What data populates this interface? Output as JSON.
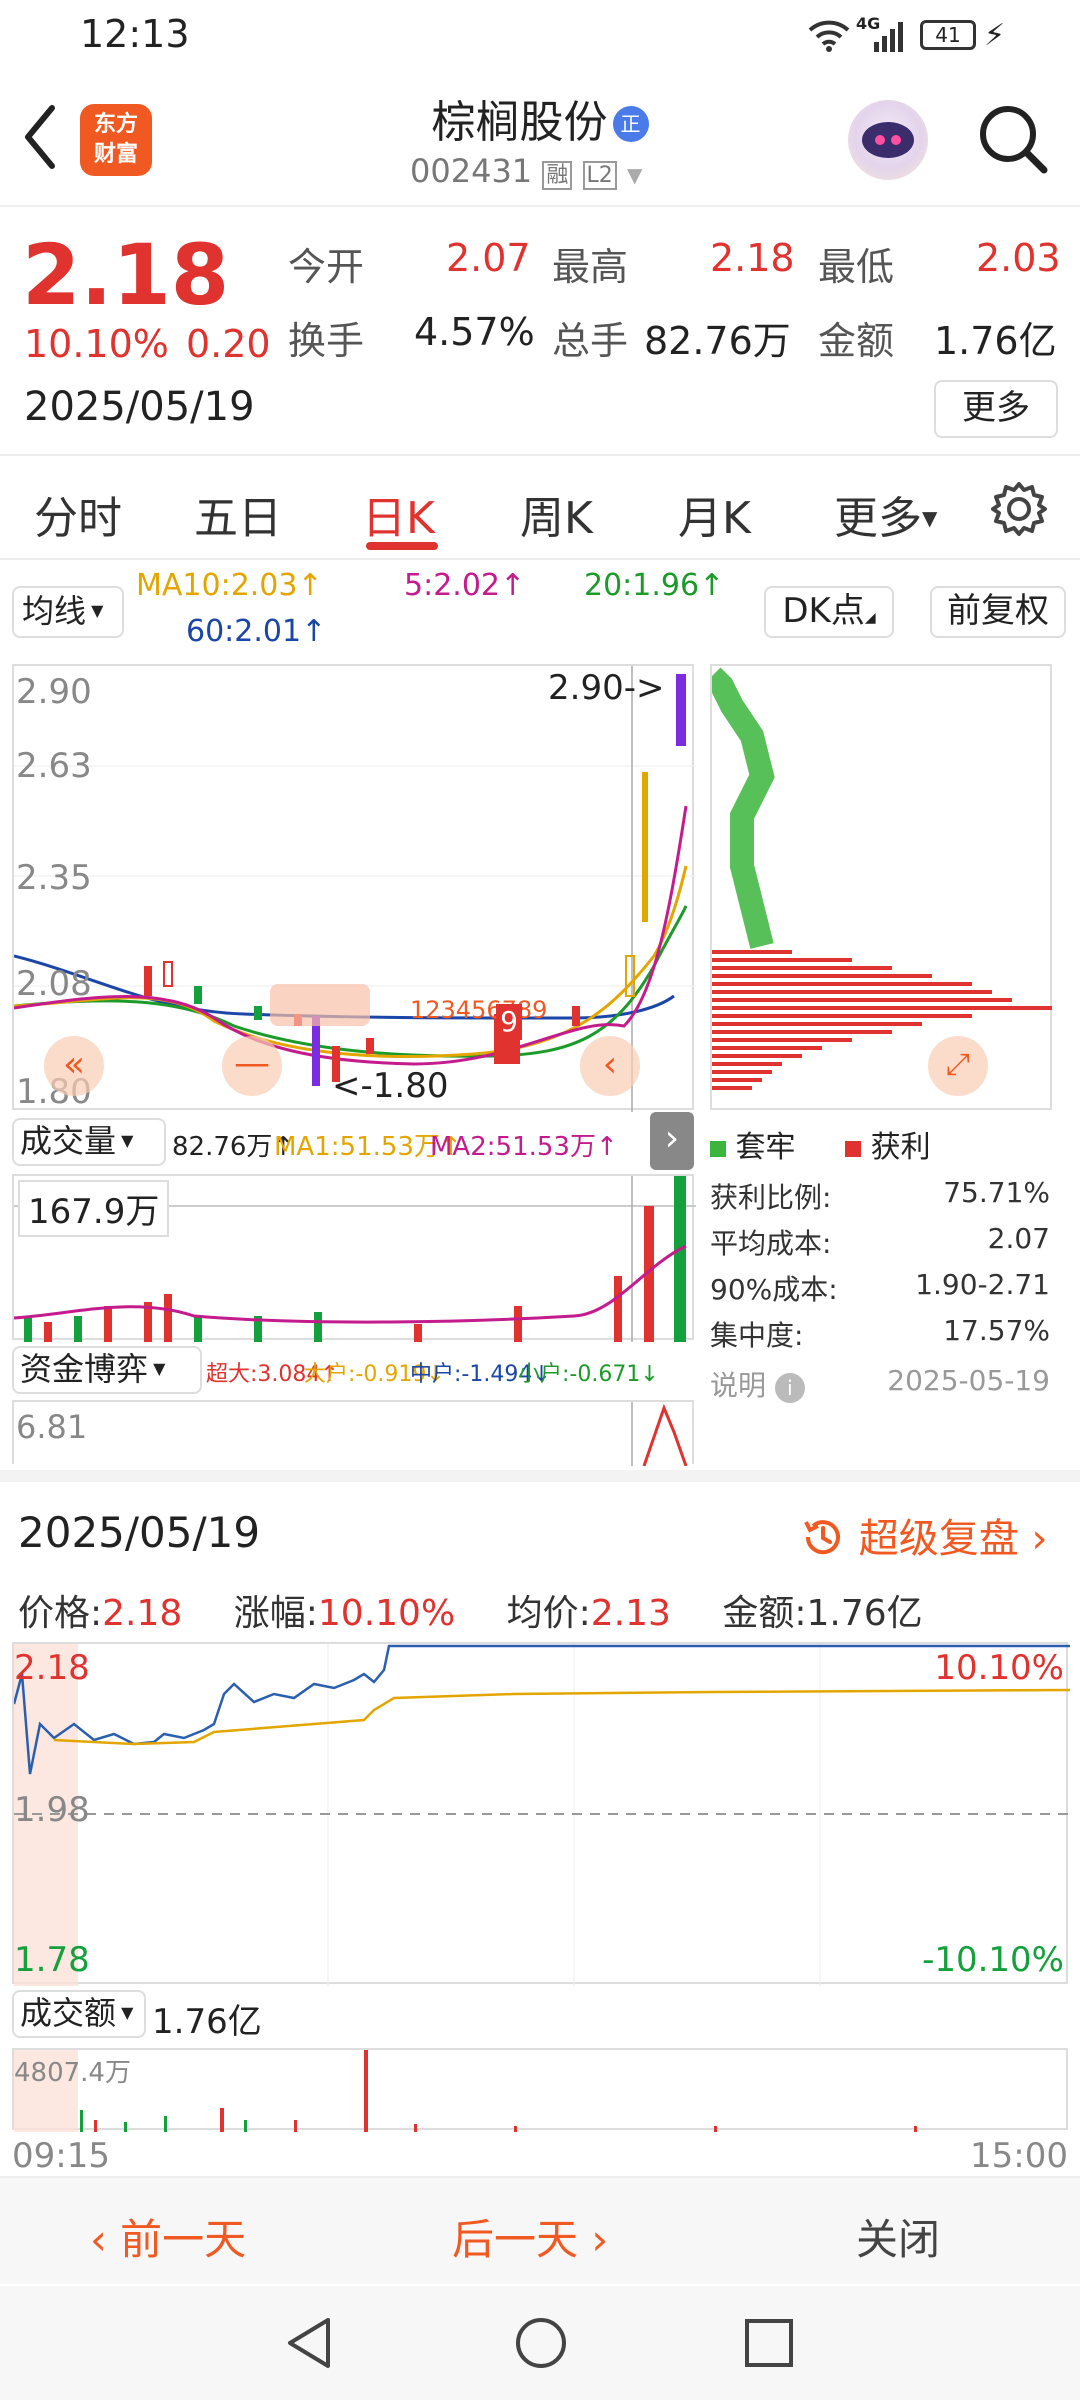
{
  "status_bar": {
    "time": "12:13",
    "network": "4G",
    "battery": "41"
  },
  "header": {
    "logo_line1": "东方",
    "logo_line2": "财富",
    "stock_name": "棕榈股份",
    "badge": "正",
    "stock_code": "002431",
    "tag_rong": "融",
    "tag_l2": "L2"
  },
  "quote": {
    "price": "2.18",
    "change_pct": "10.10%",
    "change": "0.20",
    "date": "2025/05/19",
    "open_label": "今开",
    "open": "2.07",
    "high_label": "最高",
    "high": "2.18",
    "low_label": "最低",
    "low": "2.03",
    "turnover_label": "换手",
    "turnover": "4.57%",
    "volume_label": "总手",
    "volume": "82.76万",
    "amount_label": "金额",
    "amount": "1.76亿",
    "more_btn": "更多"
  },
  "tabs": [
    "分时",
    "五日",
    "日K",
    "周K",
    "月K",
    "更多"
  ],
  "kline": {
    "ma_selector": "均线",
    "ma10": "MA10:2.03↑",
    "ma5": "5:2.02↑",
    "ma20": "20:1.96↑",
    "ma60": "60:2.01↑",
    "dk_btn": "DK点",
    "fq_btn": "前复权",
    "price_ticks": [
      "2.90",
      "2.63",
      "2.35",
      "2.08",
      "1.80"
    ],
    "max_label": "2.90->",
    "min_label": "<-1.80",
    "nine_label": "9",
    "seq_label": "123456789"
  },
  "volume_panel": {
    "selector": "成交量",
    "vol": "82.76万↑",
    "ma1": "MA1:51.53万↑",
    "ma2": "MA2:51.53万↑",
    "max": "167.9万"
  },
  "fund_panel": {
    "selector": "资金博弈",
    "super": "超大:3.084↑",
    "big": "大户:-0.919↓",
    "mid": "中户:-1.494↓",
    "small": "小户:-0.671↓",
    "top": "6.81"
  },
  "chip": {
    "legend_trapped": "套牢",
    "legend_profit": "获利",
    "profit_ratio_label": "获利比例:",
    "profit_ratio": "75.71%",
    "avg_cost_label": "平均成本:",
    "avg_cost": "2.07",
    "cost90_label": "90%成本:",
    "cost90": "1.90-2.71",
    "concentration_label": "集中度:",
    "concentration": "17.57%",
    "note_label": "说明",
    "note_date": "2025-05-19"
  },
  "intraday": {
    "date": "2025/05/19",
    "replay": "超级复盘",
    "price_label": "价格:",
    "price": "2.18",
    "pct_label": "涨幅:",
    "pct": "10.10%",
    "avg_label": "均价:",
    "avg": "2.13",
    "amount_label": "金额:",
    "amount": "1.76亿",
    "top_price": "2.18",
    "mid_price": "1.98",
    "bottom_price": "1.78",
    "top_pct": "10.10%",
    "bottom_pct": "-10.10%",
    "amount_selector": "成交额",
    "amount_total": "1.76亿",
    "amount_max": "4807.4万",
    "time_start": "09:15",
    "time_end": "15:00"
  },
  "footer": {
    "prev": "前一天",
    "next": "后一天",
    "close": "关闭"
  },
  "colors": {
    "up": "#e0332f",
    "down": "#14a03c",
    "accent": "#f05a22"
  }
}
